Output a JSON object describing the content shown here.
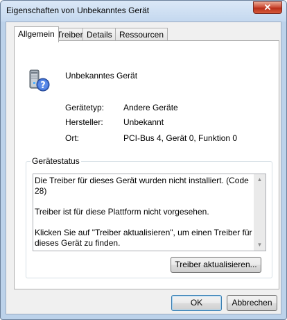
{
  "window": {
    "title": "Eigenschaften von Unbekanntes Gerät",
    "close_glyph": "✕"
  },
  "tabs": [
    {
      "label": "Allgemein",
      "active": true
    },
    {
      "label": "Treiber",
      "active": false
    },
    {
      "label": "Details",
      "active": false
    },
    {
      "label": "Ressourcen",
      "active": false
    }
  ],
  "device": {
    "name": "Unbekanntes Gerät",
    "icon": "unknown-device-icon"
  },
  "properties": [
    {
      "label": "Gerätetyp:",
      "value": "Andere Geräte"
    },
    {
      "label": "Hersteller:",
      "value": "Unbekannt"
    },
    {
      "label": "Ort:",
      "value": "PCI-Bus 4, Gerät 0, Funktion 0"
    }
  ],
  "status": {
    "group_title": "Gerätestatus",
    "lines": [
      "Die Treiber für dieses Gerät wurden nicht installiert. (Code 28)",
      "Treiber ist für diese Plattform nicht vorgesehen.",
      "Klicken Sie auf \"Treiber aktualisieren\", um einen Treiber für dieses Gerät zu finden."
    ],
    "scroll_up": "▲",
    "scroll_down": "▼"
  },
  "buttons": {
    "update_driver": "Treiber aktualisieren...",
    "ok": "OK",
    "cancel": "Abbrechen"
  },
  "colors": {
    "window_frame": "#bcd2ea",
    "close_button": "#c9452f",
    "default_button_border": "#3c7fb1"
  }
}
